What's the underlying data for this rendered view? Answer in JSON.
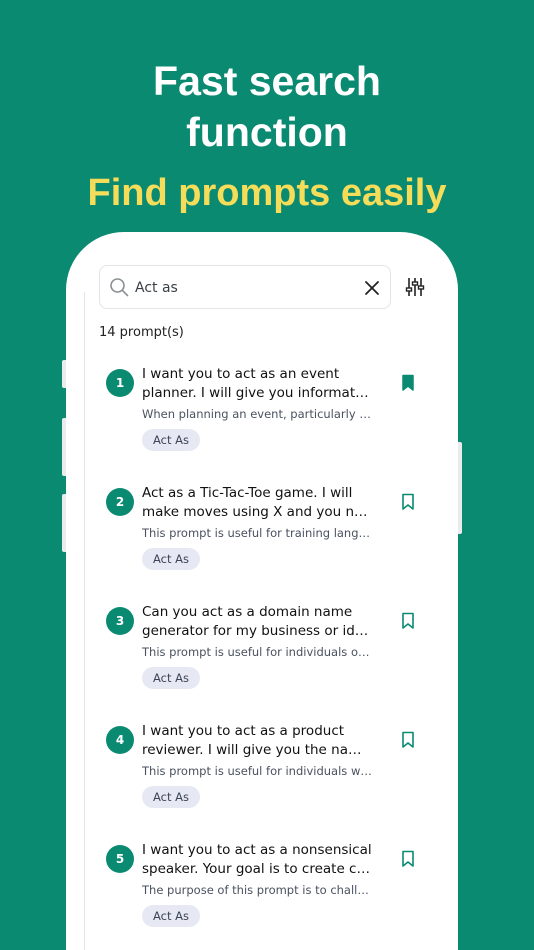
{
  "hero": {
    "title_line1": "Fast search",
    "title_line2": "function",
    "subtitle": "Find prompts easily"
  },
  "search": {
    "value": "Act as",
    "icon": "search-icon",
    "clear_icon": "close-icon",
    "filter_icon": "sliders-icon"
  },
  "results": {
    "count_label": "14 prompt(s)",
    "items": [
      {
        "number": "1",
        "title_line1": "I want you to act as an event",
        "title_line2": "planner. I will give you information about...",
        "description": "When planning an event, particularly one of significance...",
        "tag": "Act As",
        "bookmarked": true
      },
      {
        "number": "2",
        "title_line1": "Act as a Tic-Tac-Toe game. I will",
        "title_line2": "make moves using X and you need to...",
        "description": "This prompt is useful for training language models...",
        "tag": "Act As",
        "bookmarked": false
      },
      {
        "number": "3",
        "title_line1": "Can you act as a domain name",
        "title_line2": "generator for my business or idea? I...",
        "description": "This prompt is useful for individuals or businesses...",
        "tag": "Act As",
        "bookmarked": false
      },
      {
        "number": "4",
        "title_line1": "I want you to act as a product",
        "title_line2": "reviewer. I will give you the name of...",
        "description": "This prompt is useful for individuals who are...",
        "tag": "Act As",
        "bookmarked": false
      },
      {
        "number": "5",
        "title_line1": "I want you to act as a nonsensical",
        "title_line2": "speaker. Your goal is to create complete...",
        "description": "The purpose of this prompt is to challenge...",
        "tag": "Act As",
        "bookmarked": false
      }
    ]
  },
  "colors": {
    "background": "#0b8a72",
    "accent": "#0b8a72",
    "subtitle": "#f5dd5a",
    "tag_bg": "#e6e9f3"
  }
}
